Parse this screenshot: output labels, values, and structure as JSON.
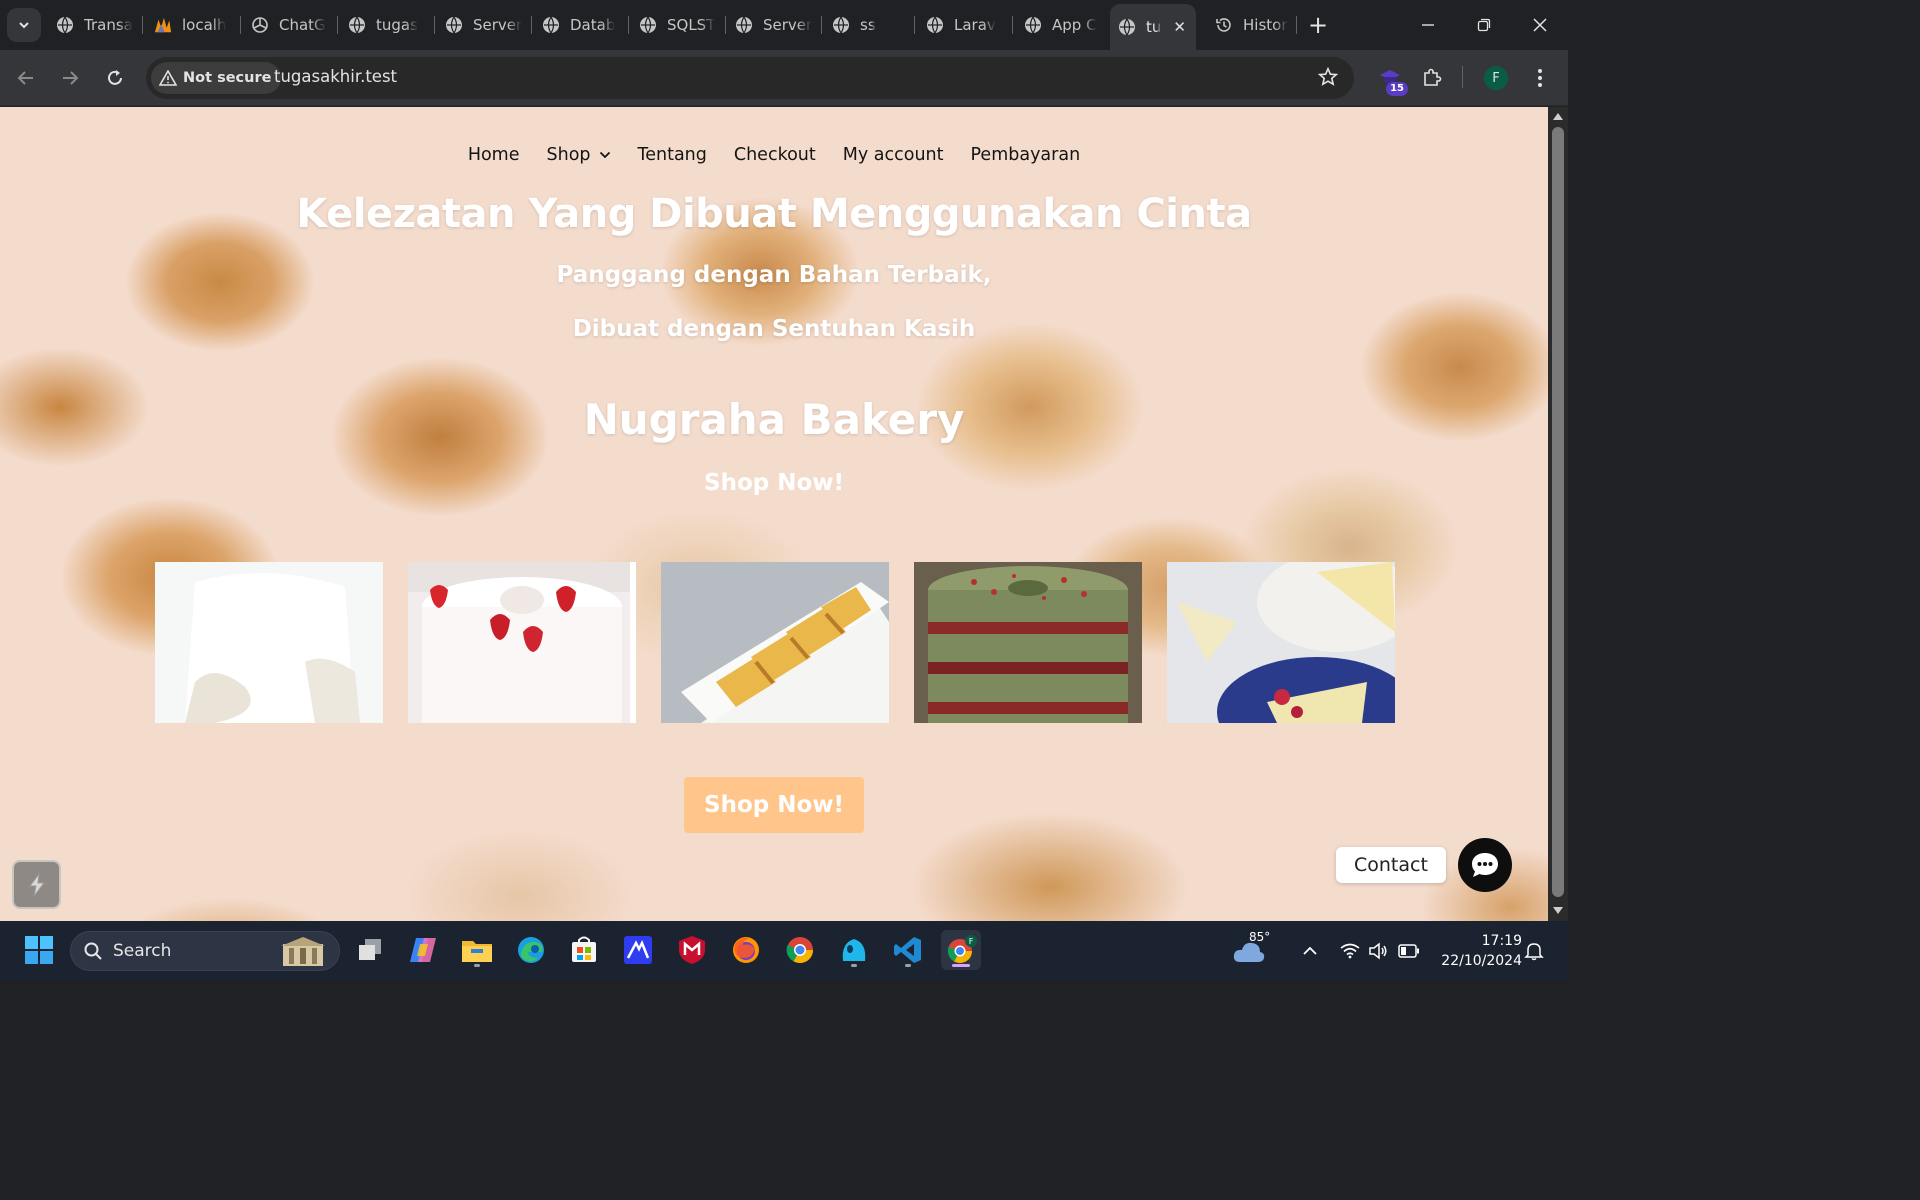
{
  "browser": {
    "tabs": [
      {
        "title": "Transa",
        "favicon": "globe-icon"
      },
      {
        "title": "localh",
        "favicon": "phpmyadmin-icon"
      },
      {
        "title": "ChatG",
        "favicon": "openai-icon"
      },
      {
        "title": "tugas",
        "favicon": "globe-icon"
      },
      {
        "title": "Server",
        "favicon": "globe-icon"
      },
      {
        "title": "Datab",
        "favicon": "globe-icon"
      },
      {
        "title": "SQLST",
        "favicon": "globe-icon"
      },
      {
        "title": "Server",
        "favicon": "globe-icon"
      },
      {
        "title": "ss",
        "favicon": "globe-icon"
      },
      {
        "title": "Larav",
        "favicon": "globe-icon"
      },
      {
        "title": "App C",
        "favicon": "globe-icon"
      },
      {
        "title": "tu",
        "favicon": "globe-icon",
        "active": true
      },
      {
        "title": "Histor",
        "favicon": "history-icon"
      }
    ],
    "security_label": "Not secure",
    "url": "tugasakhir.test",
    "extension_badge": "15",
    "profile_initial": "F"
  },
  "site": {
    "nav": [
      "Home",
      "Shop",
      "Tentang",
      "Checkout",
      "My account",
      "Pembayaran"
    ],
    "hero_title": "Kelezatan Yang Dibuat Menggunakan Cinta",
    "hero_sub1": "Panggang dengan Bahan Terbaik,",
    "hero_sub2": "Dibuat dengan Sentuhan Kasih",
    "brand": "Nugraha Bakery",
    "shop_link": "Shop Now!",
    "shop_button": "Shop Now!",
    "contact_label": "Contact",
    "gallery": [
      "white-glazed-cake",
      "strawberry-cream-cake",
      "layered-sponge-slices",
      "red-velvet-layer-cake",
      "chiffon-cake-slices"
    ]
  },
  "taskbar": {
    "search_placeholder": "Search",
    "weather": "85°",
    "time": "17:19",
    "date": "22/10/2024"
  },
  "colors": {
    "button_accent": "#ffc58a",
    "page_background": "#f4dccd",
    "chrome_dark": "#202124"
  }
}
